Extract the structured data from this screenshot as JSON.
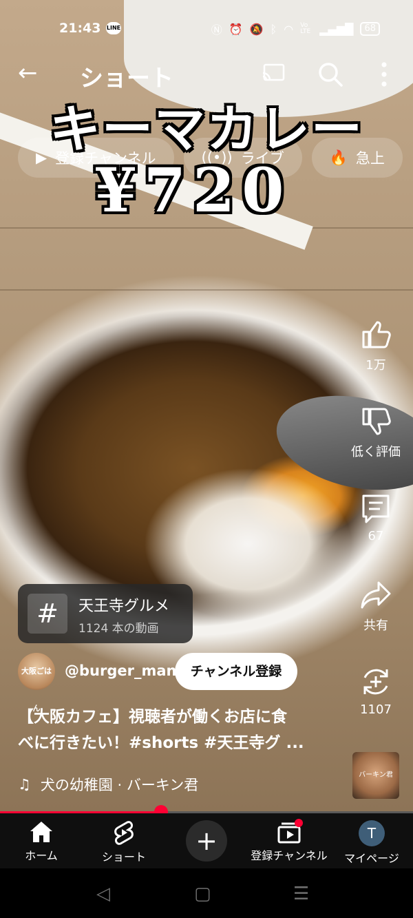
{
  "status_bar": {
    "time": "21:43",
    "line_badge": "LINE",
    "battery": "68",
    "network": "Vo LTE"
  },
  "header": {
    "title": "ショート"
  },
  "chips": [
    {
      "label": "登録チャンネル"
    },
    {
      "label": "ライブ"
    },
    {
      "label": "急上"
    }
  ],
  "video_overlay": {
    "title": "キーマカレー",
    "price": "¥720"
  },
  "actions": {
    "like_count": "1万",
    "dislike_label": "低く評価",
    "comment_count": "67",
    "share_label": "共有",
    "remix_count": "1107"
  },
  "hashtag_card": {
    "title": "天王寺グルメ",
    "subtitle": "1124 本の動画",
    "symbol": "#"
  },
  "channel": {
    "handle": "@burger_man",
    "avatar_text": "大阪ごはん",
    "subscribe_label": "チャンネル登録"
  },
  "caption": {
    "line1": "【大阪カフェ】視聴者が働くお店に食",
    "line2": "べに行きたい！#shorts #天王寺グ ..."
  },
  "music": {
    "label": "犬の幼稚園 · バーキン君",
    "thumb_text": "バーキン君"
  },
  "progress": {
    "fraction": 0.39
  },
  "nav": {
    "home": "ホーム",
    "shorts": "ショート",
    "create": "+",
    "subscriptions": "登録チャンネル",
    "mypage": "マイページ",
    "avatar_letter": "T"
  },
  "colors": {
    "accent": "#ff0033",
    "nav_bg": "#0f0f0f"
  }
}
